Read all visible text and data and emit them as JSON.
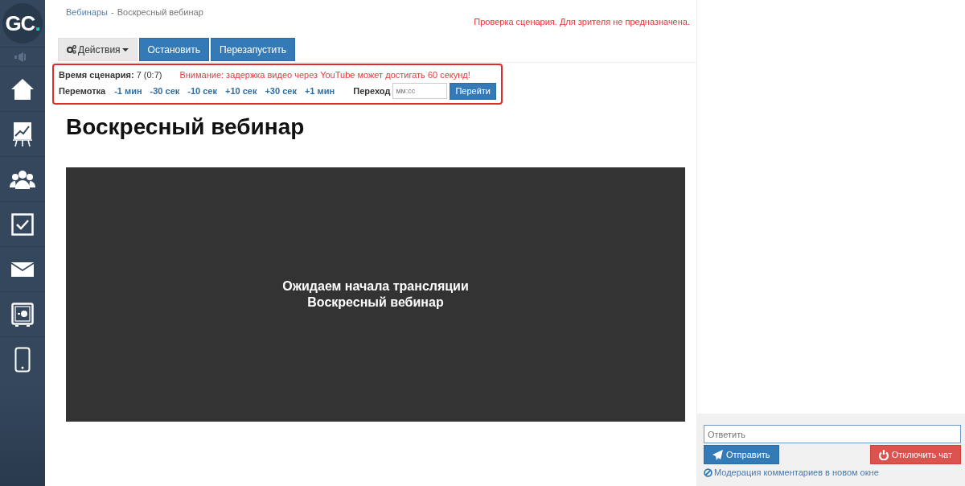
{
  "sidebar": {
    "logo": {
      "text": "GC",
      "dot": "."
    },
    "items": [
      {
        "kind": "speaker"
      },
      {
        "kind": "home"
      },
      {
        "kind": "chart"
      },
      {
        "kind": "users"
      },
      {
        "kind": "check"
      },
      {
        "kind": "mail"
      },
      {
        "kind": "safe"
      },
      {
        "kind": "phone"
      }
    ]
  },
  "breadcrumb": {
    "parent": "Вебинары",
    "separator": "-",
    "current": "Воскресный вебинар"
  },
  "notice": "Проверка сценария. Для зрителя не предназначена.",
  "toolbar": [
    {
      "label": "Действия",
      "kind": "dropdown"
    },
    {
      "label": "Остановить",
      "kind": "primary"
    },
    {
      "label": "Перезапустить",
      "kind": "primary"
    }
  ],
  "scenario": {
    "time_label": "Время сценария:",
    "time_value": "7 (0:7)",
    "warning": "Внимание: задержка видео через YouTube может достигать 60 секунд!",
    "rewind_label": "Перемотка",
    "rewind": [
      "-1 мин",
      "-30 сек",
      "-10 сек",
      "+10 сек",
      "+30 сек",
      "+1 мин"
    ],
    "goto_label": "Переход",
    "goto_placeholder": "мм:сс",
    "goto_button": "Перейти"
  },
  "title": "Воскресный вебинар",
  "video": {
    "lines": [
      "Ожидаем начала трансляции",
      "Воскресный вебинар"
    ]
  },
  "chat": {
    "placeholder": "Ответить",
    "send": "Отправить",
    "disable": "Отключить чат",
    "moderation": "Модерация комментариев в новом окне"
  }
}
